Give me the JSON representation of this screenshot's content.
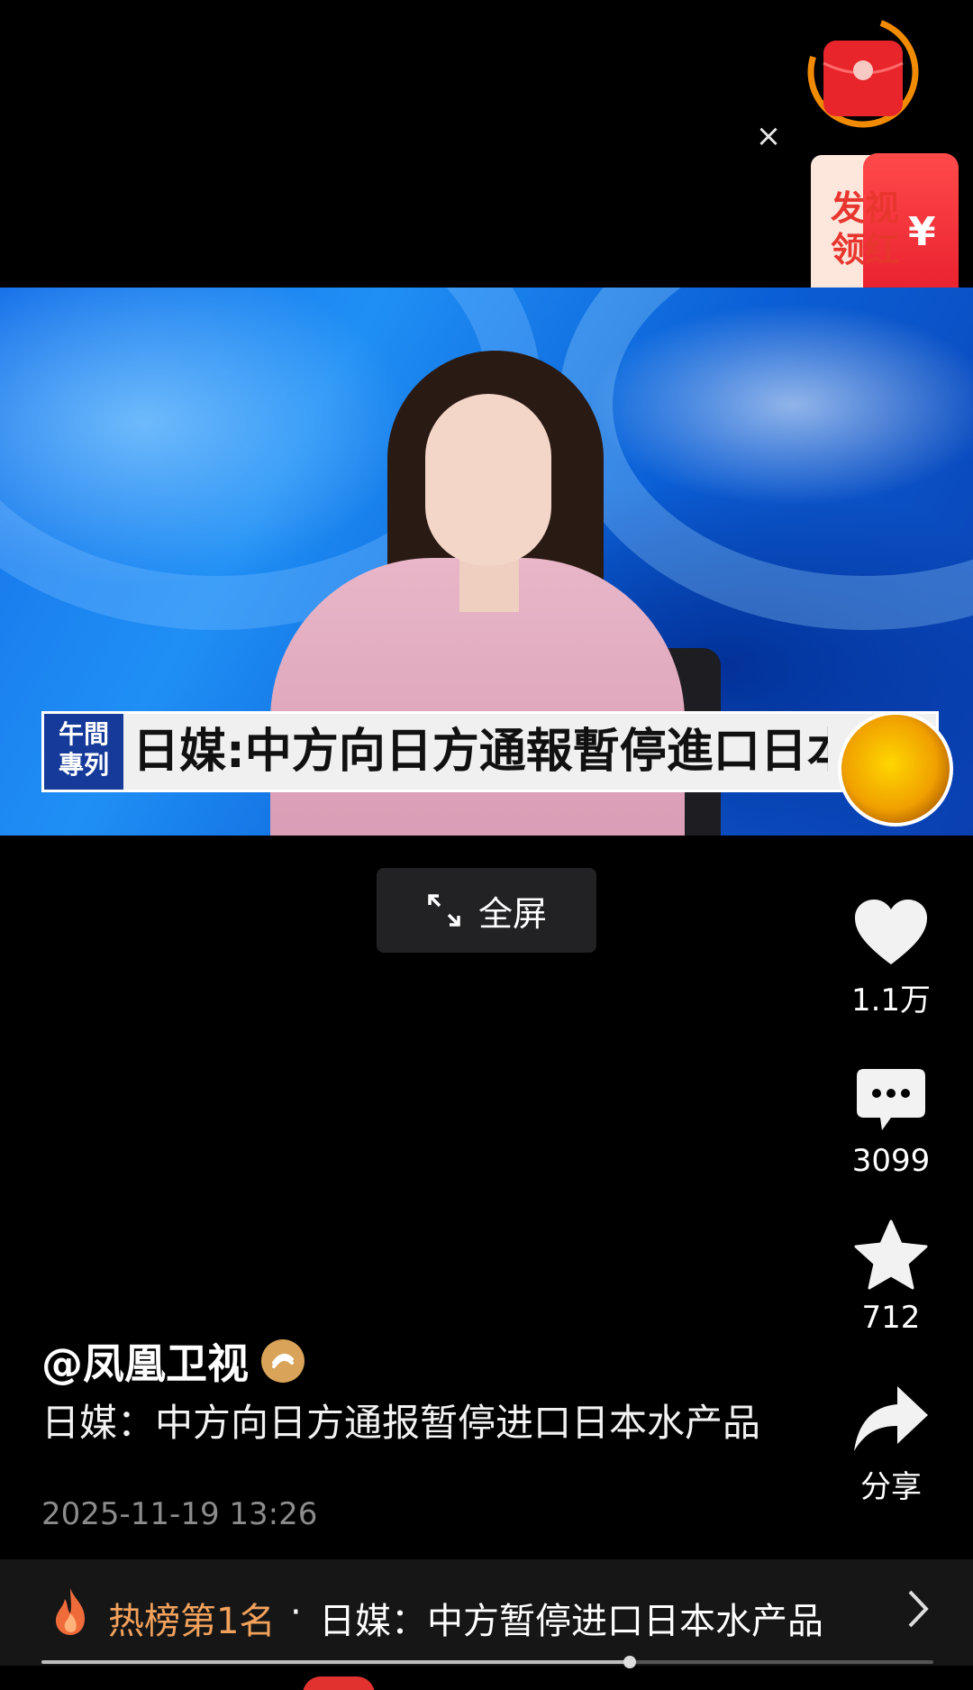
{
  "redpacket": {
    "card_text": "发视\n领红",
    "yuan_symbol": "¥",
    "close_symbol": "×"
  },
  "video": {
    "logo_text": "午間\n專列",
    "headline": "日媒:中方向日方通報暫停進口日本水產"
  },
  "fullscreen": {
    "label": "全屏"
  },
  "actions": {
    "likes": "1.1万",
    "comments": "3099",
    "favorites": "712",
    "share_label": "分享"
  },
  "post": {
    "author": "@凤凰卫视",
    "caption": "日媒：中方向日方通报暂停进口日本水产品",
    "timestamp": "2025-11-19 13:26"
  },
  "hot": {
    "rank": "热榜第1名",
    "separator": "·",
    "title": "日媒：中方暂停进口日本水产品"
  },
  "playback": {
    "progress": 0.66
  },
  "colors": {
    "background": "#000000",
    "hot_rank": "#f2a25c",
    "verified": "#d9a35a",
    "red_packet": "#e5192a"
  }
}
